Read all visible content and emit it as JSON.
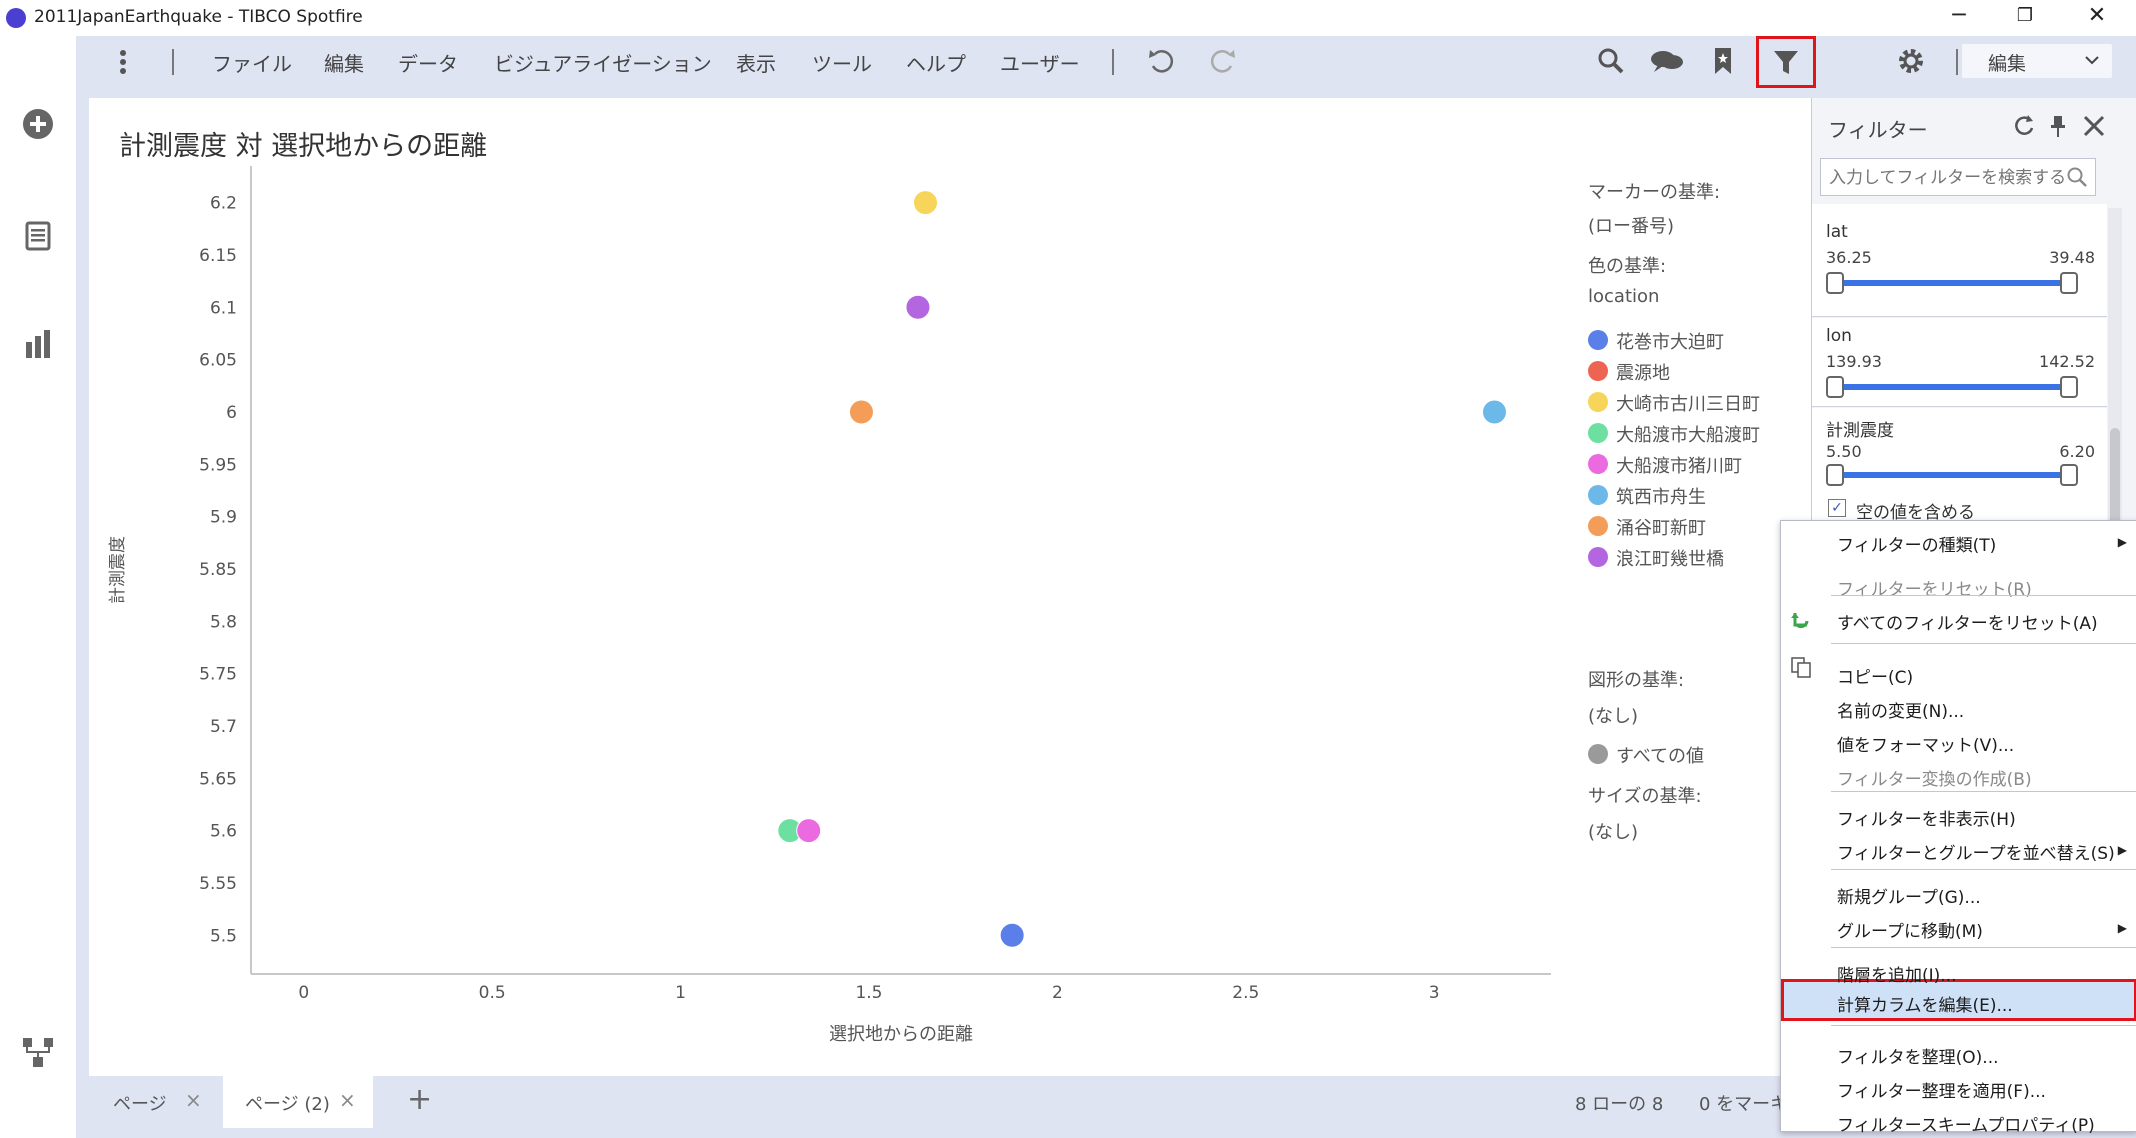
{
  "window": {
    "title": "2011JapanEarthquake - TIBCO Spotfire",
    "controls": [
      "─",
      "❐",
      "✕"
    ]
  },
  "menubar": {
    "items": [
      "ファイル",
      "編集",
      "データ",
      "ビジュアライゼーション",
      "表示",
      "ツール",
      "ヘルプ",
      "ユーザー"
    ],
    "mode_select": "編集"
  },
  "visualization": {
    "title": "計測震度 対 選択地からの距離"
  },
  "chart_data": {
    "type": "scatter",
    "xlabel": "選択地からの距離",
    "ylabel": "計測震度",
    "xlim": [
      -0.14,
      3.31
    ],
    "ylim": [
      5.463,
      6.235
    ],
    "x_ticks": [
      0,
      0.5,
      1,
      1.5,
      2,
      2.5,
      3
    ],
    "y_ticks": [
      5.5,
      5.55,
      5.6,
      5.65,
      5.7,
      5.75,
      5.8,
      5.85,
      5.9,
      5.95,
      6,
      6.05,
      6.1,
      6.15,
      6.2
    ],
    "x_tick_labels": [
      "0",
      "0.5",
      "1",
      "1.5",
      "2",
      "2.5",
      "3"
    ],
    "y_tick_labels": [
      "5.5",
      "5.55",
      "5.6",
      "5.65",
      "5.7",
      "5.75",
      "5.8",
      "5.85",
      "5.9",
      "5.95",
      "6",
      "6.05",
      "6.1",
      "6.15",
      "6.2"
    ],
    "points": [
      {
        "location": "大崎市古川三日町",
        "x": 1.65,
        "y": 6.2,
        "color": "#f7d55a"
      },
      {
        "location": "浪江町幾世橋",
        "x": 1.63,
        "y": 6.1,
        "color": "#b366e0"
      },
      {
        "location": "涌谷町新町",
        "x": 1.48,
        "y": 6.0,
        "color": "#f49d58"
      },
      {
        "location": "筑西市舟生",
        "x": 3.16,
        "y": 6.0,
        "color": "#6cb8e8"
      },
      {
        "location": "大船渡市大船渡町",
        "x": 1.29,
        "y": 5.6,
        "color": "#6be0a0"
      },
      {
        "location": "大船渡市猪川町",
        "x": 1.34,
        "y": 5.6,
        "color": "#ec6ae0"
      },
      {
        "location": "花巻市大迫町",
        "x": 1.88,
        "y": 5.5,
        "color": "#5b7fe8"
      }
    ],
    "grid": false
  },
  "legend": {
    "marker_by_label": "マーカーの基準:",
    "marker_by_value": "(ロー番号)",
    "color_by_label": "色の基準:",
    "color_by_value": "location",
    "entries": [
      {
        "label": "花巻市大迫町",
        "color": "#5b7fe8"
      },
      {
        "label": "震源地",
        "color": "#ee6452"
      },
      {
        "label": "大崎市古川三日町",
        "color": "#f7d55a"
      },
      {
        "label": "大船渡市大船渡町",
        "color": "#6be0a0"
      },
      {
        "label": "大船渡市猪川町",
        "color": "#ec6ae0"
      },
      {
        "label": "筑西市舟生",
        "color": "#6cb8e8"
      },
      {
        "label": "涌谷町新町",
        "color": "#f49d58"
      },
      {
        "label": "浪江町幾世橋",
        "color": "#b366e0"
      }
    ],
    "shape_by_label": "図形の基準:",
    "shape_by_value": "(なし)",
    "shape_entry": "すべての値",
    "size_by_label": "サイズの基準:",
    "size_by_value": "(なし)"
  },
  "tabs": {
    "pages": [
      {
        "label": "ページ",
        "active": false
      },
      {
        "label": "ページ (2)",
        "active": true
      }
    ],
    "close": "×",
    "add": "+"
  },
  "status": {
    "rows": "8 ローの 8",
    "marked": "0 をマーキ"
  },
  "filter_panel": {
    "title": "フィルター",
    "search_placeholder": "入力してフィルターを検索する",
    "filters": [
      {
        "name": "lat",
        "min": "36.25",
        "max": "39.48"
      },
      {
        "name": "lon",
        "min": "139.93",
        "max": "142.52"
      },
      {
        "name": "計測震度",
        "min": "5.50",
        "max": "6.20"
      }
    ],
    "include_empty": "空の値を含める",
    "include_empty_checked": true
  },
  "context_menu": {
    "items": [
      {
        "label": "フィルターの種類(T)",
        "disabled": false,
        "submenu": true
      },
      {
        "label": "フィルターをリセット(R)",
        "disabled": true
      },
      {
        "label": "すべてのフィルターをリセット(A)",
        "disabled": false
      },
      {
        "label": "コピー(C)",
        "disabled": false
      },
      {
        "label": "名前の変更(N)...",
        "disabled": false
      },
      {
        "label": "値をフォーマット(V)...",
        "disabled": false
      },
      {
        "label": "フィルター変換の作成(B)",
        "disabled": true
      },
      {
        "label": "フィルターを非表示(H)",
        "disabled": false
      },
      {
        "label": "フィルターとグループを並べ替え(S)",
        "disabled": false,
        "submenu": true
      },
      {
        "label": "新規グループ(G)...",
        "disabled": false
      },
      {
        "label": "グループに移動(M)",
        "disabled": false,
        "submenu": true
      },
      {
        "label": "階層を追加(I)...",
        "disabled": false
      },
      {
        "label": "計算カラムを編集(E)...",
        "disabled": false,
        "highlighted": true
      },
      {
        "label": "フィルタを整理(O)...",
        "disabled": false
      },
      {
        "label": "フィルター整理を適用(F)...",
        "disabled": false
      },
      {
        "label": "フィルタースキームプロパティ(P)",
        "disabled": false
      }
    ]
  }
}
